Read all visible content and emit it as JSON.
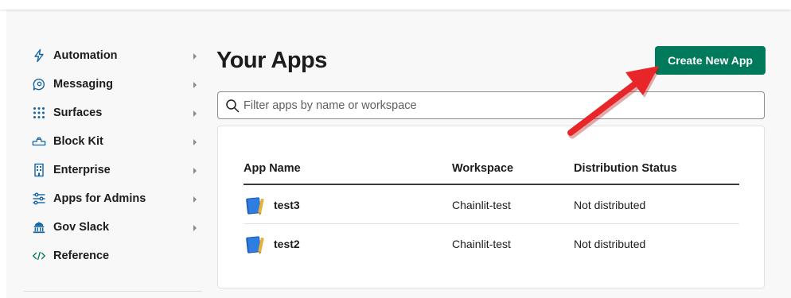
{
  "sidebar": {
    "items": [
      {
        "label": "Automation",
        "icon": "lightning-icon",
        "has_chevron": true
      },
      {
        "label": "Messaging",
        "icon": "message-bubble-icon",
        "has_chevron": true
      },
      {
        "label": "Surfaces",
        "icon": "grid-dots-icon",
        "has_chevron": true
      },
      {
        "label": "Block Kit",
        "icon": "blocks-icon",
        "has_chevron": true
      },
      {
        "label": "Enterprise",
        "icon": "building-icon",
        "has_chevron": true
      },
      {
        "label": "Apps for Admins",
        "icon": "sliders-icon",
        "has_chevron": true
      },
      {
        "label": "Gov Slack",
        "icon": "government-building-icon",
        "has_chevron": true
      },
      {
        "label": "Reference",
        "icon": "code-brackets-icon",
        "has_chevron": false
      }
    ]
  },
  "main": {
    "title": "Your Apps",
    "create_button": "Create New App",
    "search": {
      "placeholder": "Filter apps by name or workspace",
      "value": ""
    },
    "table": {
      "columns": [
        "App Name",
        "Workspace",
        "Distribution Status"
      ],
      "rows": [
        {
          "app_name": "test3",
          "workspace": "Chainlit-test",
          "status": "Not distributed"
        },
        {
          "app_name": "test2",
          "workspace": "Chainlit-test",
          "status": "Not distributed"
        }
      ]
    }
  },
  "colors": {
    "accent_green": "#007a5a",
    "icon_green": "#007a5a",
    "icon_blue": "#1264a3",
    "annotation_arrow": "#e8262a"
  }
}
